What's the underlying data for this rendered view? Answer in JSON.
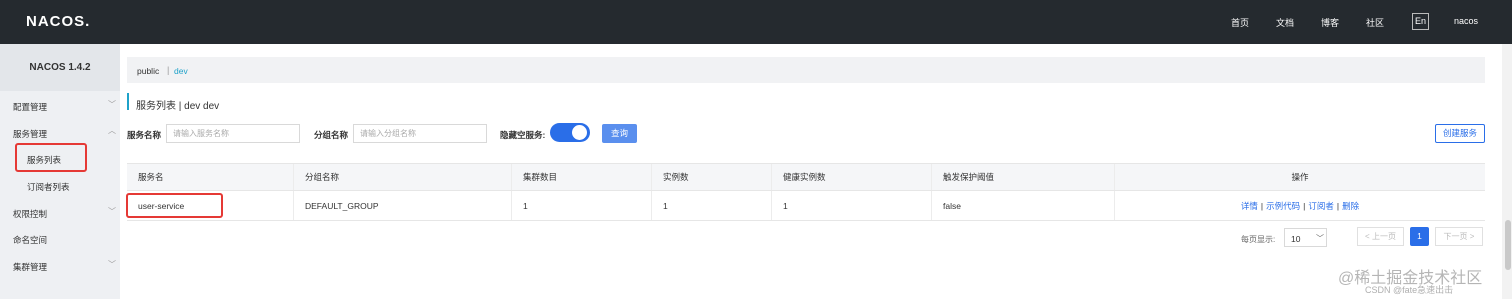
{
  "header": {
    "logo": "NACOS.",
    "nav": [
      "首页",
      "文档",
      "博客",
      "社区"
    ],
    "lang": "En",
    "user": "nacos"
  },
  "sidebar": {
    "title": "NACOS 1.4.2",
    "items": [
      {
        "label": "配置管理"
      },
      {
        "label": "服务管理",
        "children": [
          "服务列表",
          "订阅者列表"
        ]
      },
      {
        "label": "权限控制"
      },
      {
        "label": "命名空间"
      },
      {
        "label": "集群管理"
      }
    ]
  },
  "breadcrumb": {
    "namespaces": [
      "public",
      "dev"
    ],
    "separator": "|",
    "active": "dev"
  },
  "page": {
    "title": "服务列表 | dev dev"
  },
  "filters": {
    "service_name_label": "服务名称",
    "service_name_placeholder": "请输入服务名称",
    "group_name_label": "分组名称",
    "group_name_placeholder": "请输入分组名称",
    "hide_empty_label": "隐藏空服务:",
    "hide_empty_on": true,
    "query_button": "查询",
    "create_button": "创建服务"
  },
  "table": {
    "columns": [
      "服务名",
      "分组名称",
      "集群数目",
      "实例数",
      "健康实例数",
      "触发保护阈值",
      "操作"
    ],
    "rows": [
      {
        "service_name": "user-service",
        "group": "DEFAULT_GROUP",
        "cluster_count": "1",
        "instance_count": "1",
        "healthy_count": "1",
        "protect_threshold": "false",
        "actions": [
          "详情",
          "示例代码",
          "订阅者",
          "删除"
        ]
      }
    ]
  },
  "pagination": {
    "page_size_label": "每页显示:",
    "page_size": "10",
    "prev": "< 上一页",
    "next": "下一页 >",
    "current_page": "1"
  },
  "watermark": {
    "main": "@稀土掘金技术社区",
    "sub": "CSDN @fate急速出击"
  },
  "colors": {
    "topbar": "#252a2f",
    "accent": "#2a6ee8",
    "link": "#1fa2c9",
    "highlight_box": "#e53935"
  }
}
